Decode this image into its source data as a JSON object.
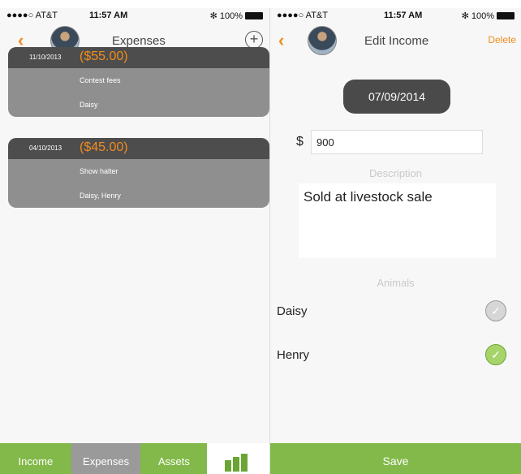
{
  "left_screen": {
    "status": {
      "carrier": "●●●●○ AT&T",
      "time": "11:57 AM",
      "battery": "100%"
    },
    "nav": {
      "back": "‹",
      "title": "Expenses",
      "add": "+"
    },
    "expenses": [
      {
        "date": "11/10/2013",
        "amount": "($55.00)",
        "description": "Contest fees",
        "animals": "Daisy"
      },
      {
        "date": "04/10/2013",
        "amount": "($45.00)",
        "description": "Show halter",
        "animals": "Daisy, Henry"
      }
    ],
    "tabs": [
      {
        "label": "Income"
      },
      {
        "label": "Expenses"
      },
      {
        "label": "Assets"
      }
    ],
    "icons": {
      "chart": "bar-chart-icon",
      "avatar": "avatar-photo"
    },
    "colors": {
      "accent": "#f28c1c",
      "tab_green": "#82b94a",
      "tab_selected": "#9a9a9a"
    }
  },
  "right_screen": {
    "status": {
      "carrier": "●●●●○ AT&T",
      "time": "11:57 AM",
      "battery": "100%"
    },
    "nav": {
      "back": "‹",
      "title": "Edit Income",
      "delete": "Delete"
    },
    "date": "07/09/2014",
    "currency": "$",
    "amount": "900",
    "description_label": "Description",
    "description": "Sold at livestock sale",
    "animals_label": "Animals",
    "animals": [
      {
        "name": "Daisy",
        "checked": false
      },
      {
        "name": "Henry",
        "checked": true
      }
    ],
    "save_label": "Save",
    "colors": {
      "checked": "#a7d46a",
      "unchecked": "#d6d6d6",
      "save_bar": "#82b94a"
    }
  }
}
